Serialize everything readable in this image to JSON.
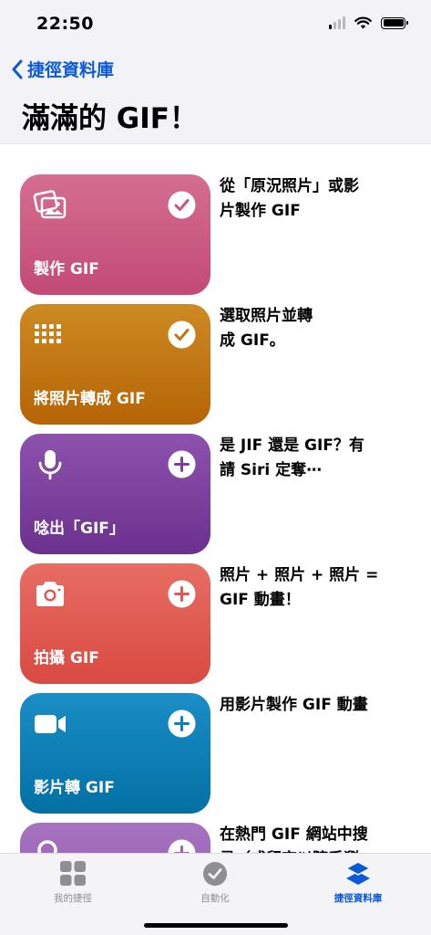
{
  "status": {
    "time": "22:50"
  },
  "nav": {
    "back_label": "捷徑資料庫",
    "title": "滿滿的 GIF！"
  },
  "shortcuts": [
    {
      "label": "製作 GIF",
      "description": "從「原況照片」或影\n片製作 GIF",
      "icon": "photos-icon",
      "action": "added-checkmark-icon",
      "color_top": "#d56e91",
      "color_bottom": "#c24a74"
    },
    {
      "label": "將照片轉成 GIF",
      "description": "選取照片並轉\n成 GIF。",
      "icon": "grid-dots-icon",
      "action": "added-checkmark-icon",
      "color_top": "#cd8a22",
      "color_bottom": "#b66405"
    },
    {
      "label": "唸出「GIF」",
      "description": "是 JIF 還是 GIF？有\n請 Siri 定奪⋯",
      "icon": "microphone-icon",
      "action": "add-plus-icon",
      "color_top": "#8d52ad",
      "color_bottom": "#6b318e"
    },
    {
      "label": "拍攝 GIF",
      "description": "照片 + 照片 + 照片 =\nGIF 動畫！",
      "icon": "camera-icon",
      "action": "add-plus-icon",
      "color_top": "#e76d63",
      "color_bottom": "#d94a42"
    },
    {
      "label": "影片轉 GIF",
      "description": "用影片製作 GIF 動畫",
      "icon": "video-camera-icon",
      "action": "add-plus-icon",
      "color_top": "#1a8ec6",
      "color_bottom": "#0470a4"
    },
    {
      "label": "",
      "description": "在熱門 GIF 網站中搜\n尋（或留空以隨手瀏",
      "icon": "search-icon",
      "action": "add-plus-icon",
      "color_top": "#a673c0",
      "color_bottom": "#8d56aa"
    }
  ],
  "tabs": [
    {
      "label": "我的捷徑",
      "icon": "grid-squares-icon",
      "active": false
    },
    {
      "label": "自動化",
      "icon": "clock-check-icon",
      "active": false
    },
    {
      "label": "捷徑資料庫",
      "icon": "layers-icon",
      "active": true
    }
  ],
  "colors": {
    "accent": "#0a5ad8",
    "tab_inactive": "#8e8e93"
  }
}
